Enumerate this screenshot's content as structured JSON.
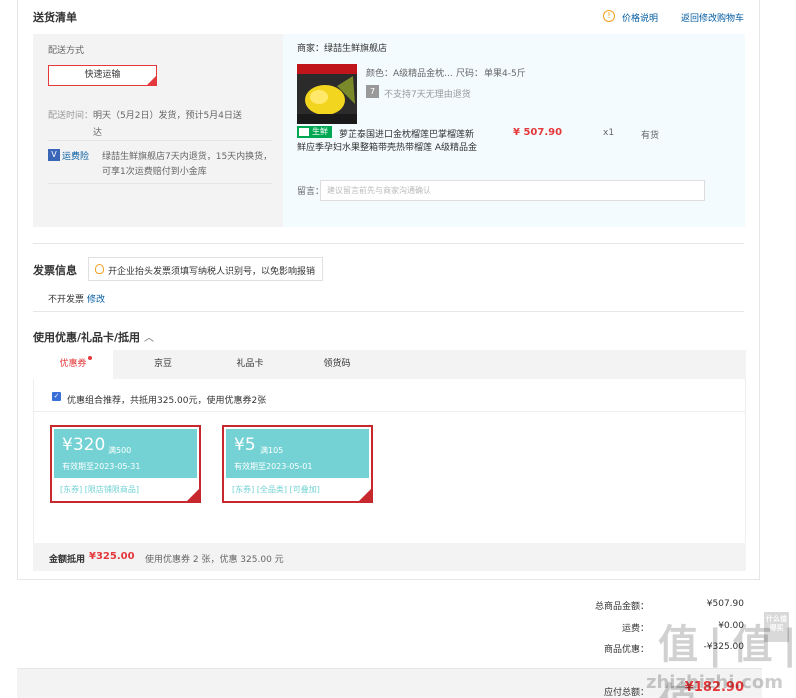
{
  "shipping": {
    "title": "送货清单",
    "price_info_link": "价格说明",
    "back_to_cart_link": "返回修改购物车",
    "method_label": "配送方式",
    "method_value": "快速运输",
    "time_label": "配送时间：",
    "time_line1": "明天（5月2日）发货，预计5月4日送",
    "time_line2": "达",
    "insurance_label": "运费险",
    "insurance_text_line1": "绿喆生鲜旗舰店7天内退货，15天内换货，",
    "insurance_text_line2": "可享1次运费赔付到小金库"
  },
  "seller": {
    "label": "商家：",
    "name": "绿喆生鲜旗舰店"
  },
  "product": {
    "color_label": "颜色：",
    "color_value": "A级精品金枕...",
    "size_label": "尺码：",
    "size_value": "单果4-5斤",
    "no_return_badge": "7",
    "no_return_text": "不支持7天无理由退货",
    "fresh_badge": "生鲜",
    "title_line1": "萝芷泰国进口金枕榴莲巴掌榴莲新",
    "title_line2": "鲜应季孕妇水果整箱带壳热带榴莲 A级精品金",
    "price": "¥ 507.90",
    "qty": "x1",
    "stock": "有货",
    "note_label": "留言：",
    "note_placeholder": "建议留言前先与商家沟通确认"
  },
  "invoice": {
    "title": "发票信息",
    "tip": "开企业抬头发票须填写纳税人识别号，以免影响报销",
    "status": "不开发票",
    "edit_link": "修改"
  },
  "discounts": {
    "title": "使用优惠/礼品卡/抵用",
    "tabs": [
      "优惠券",
      "京豆",
      "礼品卡",
      "领货码"
    ],
    "recommend_text": "优惠组合推荐，共抵用325.00元，使用优惠券2张",
    "coupons": [
      {
        "amount": "¥320",
        "condition": "满500",
        "expiry": "有效期至2023-05-31",
        "tags": "[东券]  [限店铺限商品]"
      },
      {
        "amount": "¥5",
        "condition": "满105",
        "expiry": "有效期至2023-05-01",
        "tags": "[东券]  [全品类]  [可叠加]"
      }
    ],
    "summary_label": "金额抵用",
    "summary_amount": "¥325.00",
    "summary_text": "使用优惠券 2 张，优惠 325.00 元"
  },
  "totals": {
    "goods_label": "总商品金额：",
    "goods_value": "¥507.90",
    "freight_label": "运费：",
    "freight_value": "¥0.00",
    "discount_label": "商品优惠：",
    "discount_value": "-¥325.00",
    "payable_label": "应付总额：",
    "payable_value": "¥182.90"
  },
  "watermark": {
    "logo_text": "值 | 值 | 值",
    "site": "zhizhizhi.com",
    "side_text": "什么值得买"
  },
  "colors": {
    "accent_red": "#e4393c",
    "link_blue": "#005aa0",
    "coupon_teal": "#74d2d4",
    "fresh_green": "#00a854"
  }
}
